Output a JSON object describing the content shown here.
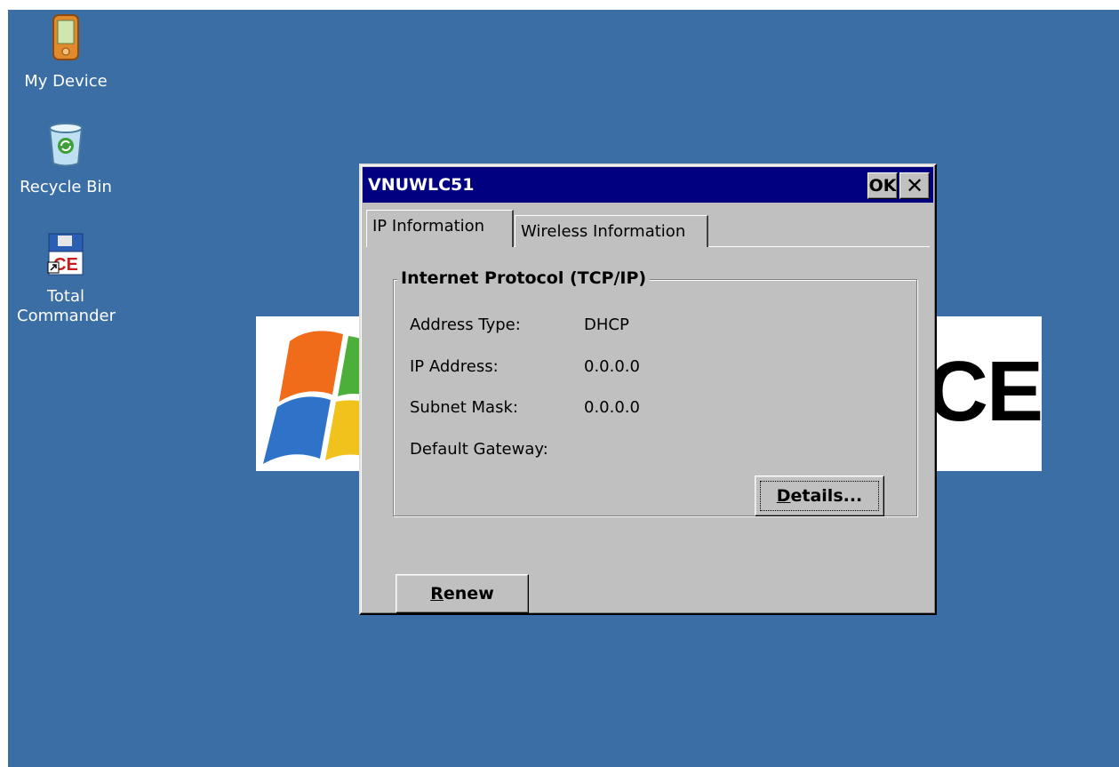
{
  "desktop": {
    "icons": [
      {
        "label": "My Device",
        "icon": "pda-device-icon"
      },
      {
        "label": "Recycle Bin",
        "icon": "recycle-bin-icon"
      },
      {
        "label_line1": "Total",
        "label_line2": "Commander",
        "icon": "total-commander-icon"
      }
    ],
    "wallpaper_text": "CE"
  },
  "dialog": {
    "title": "VNUWLC51",
    "ok_label": "OK",
    "close_label": "✕",
    "tabs": [
      {
        "label": "IP Information",
        "selected": true
      },
      {
        "label": "Wireless Information",
        "selected": false
      }
    ],
    "group_title": "Internet Protocol (TCP/IP)",
    "rows": [
      {
        "label": "Address Type:",
        "value": "DHCP"
      },
      {
        "label": "IP Address:",
        "value": "0.0.0.0"
      },
      {
        "label": "Subnet Mask:",
        "value": "0.0.0.0"
      },
      {
        "label": "Default Gateway:",
        "value": ""
      }
    ],
    "details_button": {
      "mnemonic": "D",
      "rest": "etails..."
    },
    "renew_button": {
      "mnemonic": "R",
      "rest": "enew"
    }
  },
  "colors": {
    "desktop_bg": "#3a6ea5",
    "titlebar": "#000080",
    "dialog_face": "#c0c0c0"
  }
}
